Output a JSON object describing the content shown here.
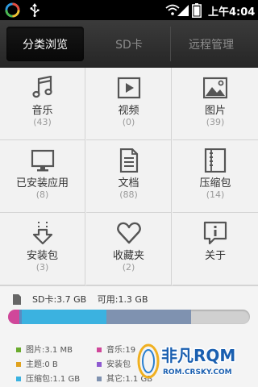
{
  "status_bar": {
    "time": "上午4:04"
  },
  "tabs": [
    {
      "label": "分类浏览",
      "active": true
    },
    {
      "label": "SD卡",
      "active": false
    },
    {
      "label": "远程管理",
      "active": false
    }
  ],
  "categories": [
    {
      "label": "音乐",
      "count": "(43)",
      "icon": "music-note-icon"
    },
    {
      "label": "视频",
      "count": "(0)",
      "icon": "video-play-icon"
    },
    {
      "label": "图片",
      "count": "(39)",
      "icon": "picture-icon"
    },
    {
      "label": "已安装应用",
      "count": "(8)",
      "icon": "monitor-icon"
    },
    {
      "label": "文档",
      "count": "(88)",
      "icon": "document-icon"
    },
    {
      "label": "压缩包",
      "count": "(14)",
      "icon": "archive-icon"
    },
    {
      "label": "安装包",
      "count": "(3)",
      "icon": "download-arrow-icon"
    },
    {
      "label": "收藏夹",
      "count": "(2)",
      "icon": "heart-icon"
    },
    {
      "label": "关于",
      "count": "",
      "icon": "info-icon"
    }
  ],
  "storage": {
    "sd_total": "SD卡:3.7 GB",
    "available": "可用:1.3 GB",
    "legend": [
      {
        "text": "图片:3.1 MB",
        "color": "#6aab2e"
      },
      {
        "text": "音乐:19",
        "color": "#d0479a"
      },
      {
        "text": "主题:0 B",
        "color": "#e0a21e"
      },
      {
        "text": "安装包",
        "color": "#8e5ad0"
      },
      {
        "text": "压缩包:1.1 GB",
        "color": "#3bb2e0"
      },
      {
        "text": "其它:1.1 GB",
        "color": "#7f92b0"
      }
    ],
    "usage_fractions": [
      0.045,
      0.012,
      0.35,
      0.35
    ]
  },
  "watermark": {
    "brand": "非凡RQM",
    "url": "ROM.CRSKY.COM"
  }
}
